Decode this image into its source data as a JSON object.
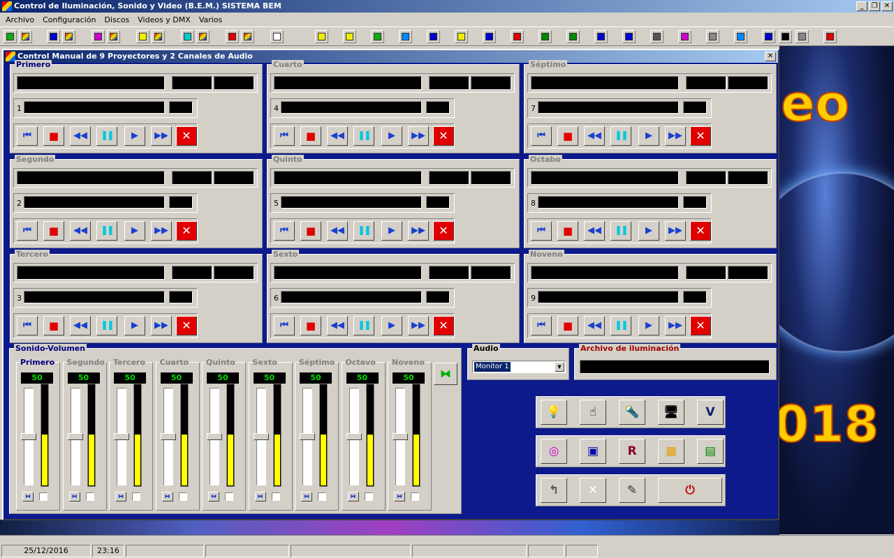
{
  "app": {
    "title": "Control de Iluminación, Sonido y Video (B.E.M.)  SISTEMA BEM",
    "win_min": "_",
    "win_restore": "❐",
    "win_close": "✕"
  },
  "menu": [
    "Archivo",
    "Configuración",
    "Discos",
    "Videos y DMX",
    "Varios"
  ],
  "mdi": {
    "title": "Control Manual de 9 Proyectores y 2 Canales de Audio",
    "close": "✕"
  },
  "projectors": [
    {
      "title": "Primero",
      "num": "1"
    },
    {
      "title": "Segundo",
      "num": "2"
    },
    {
      "title": "Tercero",
      "num": "3"
    },
    {
      "title": "Cuarto",
      "num": "4"
    },
    {
      "title": "Quinto",
      "num": "5"
    },
    {
      "title": "Sexto",
      "num": "6"
    },
    {
      "title": "Séptimo",
      "num": "7"
    },
    {
      "title": "Octabo",
      "num": "8"
    },
    {
      "title": "Noveno",
      "num": "9"
    }
  ],
  "controls": {
    "first": "⏮",
    "stop": "■",
    "rewind": "◀◀",
    "pause": "❚❚",
    "play": "▶",
    "forward": "▶▶",
    "close": "✕"
  },
  "volume": {
    "title": "Sonido-Volumen",
    "channels": [
      {
        "label": "Primero",
        "value": "50",
        "level": 0.5
      },
      {
        "label": "Segundo",
        "value": "50",
        "level": 0.5
      },
      {
        "label": "Tercero",
        "value": "50",
        "level": 0.5
      },
      {
        "label": "Cuarto",
        "value": "50",
        "level": 0.5
      },
      {
        "label": "Quinto",
        "value": "50",
        "level": 0.5
      },
      {
        "label": "Sexto",
        "value": "50",
        "level": 0.5
      },
      {
        "label": "Séptimo",
        "value": "50",
        "level": 0.5
      },
      {
        "label": "Octavo",
        "value": "50",
        "level": 0.5
      },
      {
        "label": "Noveno",
        "value": "50",
        "level": 0.5
      }
    ]
  },
  "audio": {
    "title": "Audio",
    "selected": "Monitor 1"
  },
  "lighting": {
    "title": "Archivo de iluminación"
  },
  "background": {
    "text1": "eo",
    "text2": "018"
  },
  "status": {
    "date": "25/12/2016",
    "time": "23:16"
  },
  "colors": {
    "mdi_bg": "#0c1a8c",
    "title_gradient_start": "#0a246a",
    "meter_fill": "#ffff00",
    "volume_text": "#00e000",
    "stop_red": "#e00000"
  }
}
